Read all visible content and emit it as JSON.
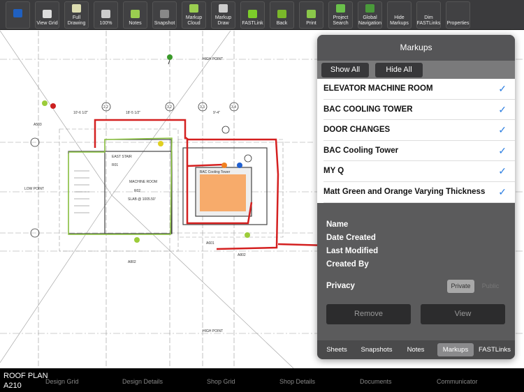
{
  "toolbar": {
    "buttons": [
      {
        "label": "",
        "icon": "fieldwire-logo-icon"
      },
      {
        "label": "View Grid",
        "icon": "grid-icon"
      },
      {
        "label": "Full Drawing",
        "icon": "full-drawing-icon"
      },
      {
        "label": "100%",
        "icon": "zoom-icon"
      },
      {
        "label": "Notes",
        "icon": "notes-icon"
      },
      {
        "label": "Snapshot",
        "icon": "camera-icon"
      },
      {
        "label": "Markup Cloud",
        "icon": "cloud-icon"
      },
      {
        "label": "Markup Draw",
        "icon": "pencil-icon"
      },
      {
        "label": "FASTLink",
        "icon": "pushpin-icon"
      },
      {
        "label": "Back",
        "icon": "back-icon"
      },
      {
        "label": "Print",
        "icon": "printer-icon"
      },
      {
        "label": "Project Search",
        "icon": "search-icon"
      },
      {
        "label": "Global Navigation",
        "icon": "globe-icon"
      },
      {
        "label": "Hide Markups",
        "icon": ""
      },
      {
        "label": "Dim FASTLinks",
        "icon": ""
      },
      {
        "label": "Properties",
        "icon": ""
      }
    ]
  },
  "drawing": {
    "labels": {
      "high_point": "HIGH POINT",
      "low_point": "LOW POINT",
      "machine_room": "MACHINE ROOM",
      "room_r02": "R02",
      "east_stair": "EAST STAIR",
      "room_r01": "R01",
      "slab": "SLAB @ 1005.50'",
      "a503": "A503",
      "a802a": "A802",
      "a802b": "A802",
      "a601": "A601",
      "cooling_tag": "BAC Cooling Tower",
      "grid_22": "2.2",
      "grid_32": "3.2",
      "grid_33": "3.3",
      "grid_34": "3.4",
      "dim1": "10'-6 1/2\"",
      "dim2": "18'-5 1/2\"",
      "dim3": "9'-4\""
    }
  },
  "panel": {
    "title": "Markups",
    "show_all": "Show All",
    "hide_all": "Hide All",
    "markups": [
      {
        "name": "ELEVATOR MACHINE ROOM",
        "checked": true
      },
      {
        "name": "BAC COOLING TOWER",
        "checked": true
      },
      {
        "name": "DOOR CHANGES",
        "checked": true
      },
      {
        "name": "BAC Cooling Tower",
        "checked": true
      },
      {
        "name": "MY Q",
        "checked": true
      },
      {
        "name": "Matt Green and Orange Varying Thickness",
        "checked": true
      }
    ],
    "check": "✓",
    "fields": {
      "name": "Name",
      "date_created": "Date Created",
      "last_modified": "Last Modified",
      "created_by": "Created By",
      "privacy": "Privacy"
    },
    "privacy": {
      "private": "Private",
      "public": "Public",
      "selected": "Private"
    },
    "remove": "Remove",
    "view": "View",
    "tabs": [
      "Sheets",
      "Snapshots",
      "Notes",
      "Markups",
      "FASTLinks"
    ],
    "active_tab": "Markups"
  },
  "bottom": {
    "sheet_name": "ROOF PLAN",
    "sheet_number": "A210",
    "nav": [
      "Design Grid",
      "Design Details",
      "Shop Grid",
      "Shop Details",
      "Documents",
      "Communicator"
    ]
  },
  "colors": {
    "accent": "#2a7de1",
    "markup_red": "#d42020",
    "markup_green": "#8cc63f",
    "markup_orange": "#f7a35c"
  }
}
